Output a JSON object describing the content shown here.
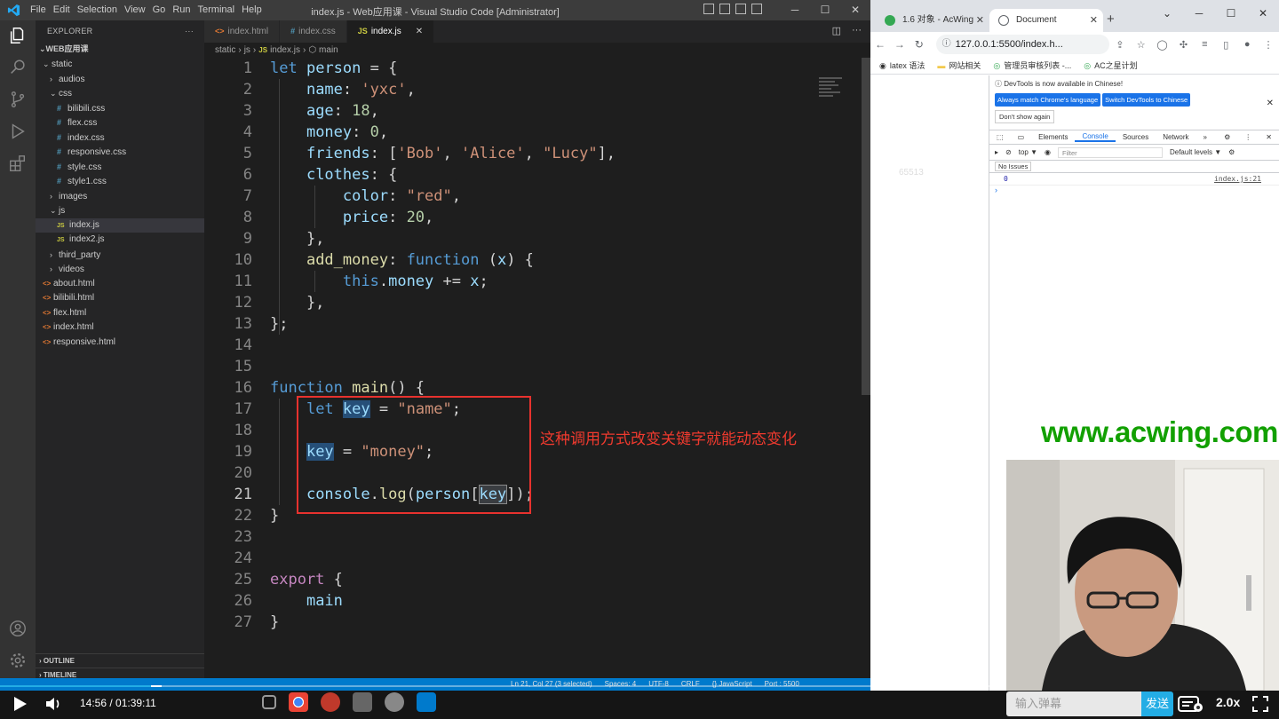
{
  "vscode": {
    "menu": [
      "File",
      "Edit",
      "Selection",
      "View",
      "Go",
      "Run",
      "Terminal",
      "Help"
    ],
    "window_title": "index.js - Web应用课 - Visual Studio Code [Administrator]",
    "explorer_label": "EXPLORER",
    "explorer_more": "···",
    "root_folder": "WEB应用课",
    "tree": [
      {
        "label": "static",
        "kind": "folder",
        "open": true,
        "depth": 0
      },
      {
        "label": "audios",
        "kind": "folder",
        "open": false,
        "depth": 1
      },
      {
        "label": "css",
        "kind": "folder",
        "open": true,
        "depth": 1
      },
      {
        "label": "bilibili.css",
        "kind": "css",
        "depth": 2
      },
      {
        "label": "flex.css",
        "kind": "css",
        "depth": 2
      },
      {
        "label": "index.css",
        "kind": "css",
        "depth": 2
      },
      {
        "label": "responsive.css",
        "kind": "css",
        "depth": 2
      },
      {
        "label": "style.css",
        "kind": "css",
        "depth": 2
      },
      {
        "label": "style1.css",
        "kind": "css",
        "depth": 2
      },
      {
        "label": "images",
        "kind": "folder",
        "open": false,
        "depth": 1
      },
      {
        "label": "js",
        "kind": "folder",
        "open": true,
        "depth": 1
      },
      {
        "label": "index.js",
        "kind": "js",
        "depth": 2,
        "active": true
      },
      {
        "label": "index2.js",
        "kind": "js",
        "depth": 2
      },
      {
        "label": "third_party",
        "kind": "folder",
        "open": false,
        "depth": 1
      },
      {
        "label": "videos",
        "kind": "folder",
        "open": false,
        "depth": 1
      },
      {
        "label": "about.html",
        "kind": "html",
        "depth": 0
      },
      {
        "label": "bilibili.html",
        "kind": "html",
        "depth": 0
      },
      {
        "label": "flex.html",
        "kind": "html",
        "depth": 0
      },
      {
        "label": "index.html",
        "kind": "html",
        "depth": 0
      },
      {
        "label": "responsive.html",
        "kind": "html",
        "depth": 0
      }
    ],
    "outline_label": "OUTLINE",
    "timeline_label": "TIMELINE",
    "tabs": [
      {
        "label": "index.html",
        "kind": "html",
        "active": false
      },
      {
        "label": "index.css",
        "kind": "css",
        "active": false
      },
      {
        "label": "index.js",
        "kind": "js",
        "active": true
      }
    ],
    "breadcrumb": [
      "static",
      "js",
      "index.js",
      "main"
    ],
    "current_line": 21,
    "code": [
      [
        [
          "k",
          "let"
        ],
        [
          "p",
          " "
        ],
        [
          "v",
          "person"
        ],
        [
          "p",
          " = {"
        ]
      ],
      [
        [
          "p",
          "    "
        ],
        [
          "v",
          "name"
        ],
        [
          "p",
          ": "
        ],
        [
          "s",
          "'yxc'"
        ],
        [
          "p",
          ","
        ]
      ],
      [
        [
          "p",
          "    "
        ],
        [
          "v",
          "age"
        ],
        [
          "p",
          ": "
        ],
        [
          "n",
          "18"
        ],
        [
          "p",
          ","
        ]
      ],
      [
        [
          "p",
          "    "
        ],
        [
          "v",
          "money"
        ],
        [
          "p",
          ": "
        ],
        [
          "n",
          "0"
        ],
        [
          "p",
          ","
        ]
      ],
      [
        [
          "p",
          "    "
        ],
        [
          "v",
          "friends"
        ],
        [
          "p",
          ": ["
        ],
        [
          "s",
          "'Bob'"
        ],
        [
          "p",
          ", "
        ],
        [
          "s",
          "'Alice'"
        ],
        [
          "p",
          ", "
        ],
        [
          "s",
          "\"Lucy\""
        ],
        [
          "p",
          "],"
        ]
      ],
      [
        [
          "p",
          "    "
        ],
        [
          "v",
          "clothes"
        ],
        [
          "p",
          ": {"
        ]
      ],
      [
        [
          "p",
          "        "
        ],
        [
          "v",
          "color"
        ],
        [
          "p",
          ": "
        ],
        [
          "s",
          "\"red\""
        ],
        [
          "p",
          ","
        ]
      ],
      [
        [
          "p",
          "        "
        ],
        [
          "v",
          "price"
        ],
        [
          "p",
          ": "
        ],
        [
          "n",
          "20"
        ],
        [
          "p",
          ","
        ]
      ],
      [
        [
          "p",
          "    },"
        ]
      ],
      [
        [
          "p",
          "    "
        ],
        [
          "f",
          "add_money"
        ],
        [
          "p",
          ": "
        ],
        [
          "k",
          "function"
        ],
        [
          "p",
          " ("
        ],
        [
          "v",
          "x"
        ],
        [
          "p",
          ") {"
        ]
      ],
      [
        [
          "p",
          "        "
        ],
        [
          "k",
          "this"
        ],
        [
          "p",
          "."
        ],
        [
          "v",
          "money"
        ],
        [
          "p",
          " += "
        ],
        [
          "v",
          "x"
        ],
        [
          "p",
          ";"
        ]
      ],
      [
        [
          "p",
          "    },"
        ]
      ],
      [
        [
          "p",
          "};"
        ]
      ],
      [],
      [],
      [
        [
          "k",
          "function"
        ],
        [
          "p",
          " "
        ],
        [
          "f",
          "main"
        ],
        [
          "p",
          "() {"
        ]
      ],
      [
        [
          "p",
          "    "
        ],
        [
          "k",
          "let"
        ],
        [
          "p",
          " "
        ],
        [
          "vh",
          "key"
        ],
        [
          "p",
          " = "
        ],
        [
          "s",
          "\"name\""
        ],
        [
          "p",
          ";"
        ]
      ],
      [],
      [
        [
          "p",
          "    "
        ],
        [
          "vh",
          "key"
        ],
        [
          "p",
          " = "
        ],
        [
          "s",
          "\"money\""
        ],
        [
          "p",
          ";"
        ]
      ],
      [],
      [
        [
          "p",
          "    "
        ],
        [
          "v",
          "console"
        ],
        [
          "p",
          "."
        ],
        [
          "f",
          "log"
        ],
        [
          "p",
          "("
        ],
        [
          "v",
          "person"
        ],
        [
          "p",
          "["
        ],
        [
          "vh2",
          "key"
        ],
        [
          "p",
          "]);"
        ]
      ],
      [
        [
          "p",
          "}"
        ]
      ],
      [],
      [],
      [
        [
          "kw",
          "export"
        ],
        [
          "p",
          " {"
        ]
      ],
      [
        [
          "p",
          "    "
        ],
        [
          "v",
          "main"
        ]
      ],
      [
        [
          "p",
          "}"
        ]
      ]
    ],
    "annotation": "这种调用方式改变关键字就能动态变化",
    "status": [
      "Ln 21, Col 27 (3 selected)",
      "Spaces: 4",
      "UTF-8",
      "CRLF",
      "{} JavaScript",
      "Port : 5500"
    ]
  },
  "chrome": {
    "tabs": [
      {
        "label": "1.6 对象 - AcWing",
        "active": false,
        "icon_color": "#34a853"
      },
      {
        "label": "Document",
        "active": true,
        "icon_color": "#5f6368"
      }
    ],
    "url": "127.0.0.1:5500/index.h...",
    "bookmarks": [
      "latex 语法",
      "网站相关",
      "管理员审核列表 -...",
      "AC之星计划"
    ],
    "page_number": "65513",
    "devtools": {
      "banner": "DevTools is now available in Chinese!",
      "btn_match": "Always match Chrome's language",
      "btn_switch": "Switch DevTools to Chinese",
      "btn_dont": "Don't show again",
      "tabs": [
        "Elements",
        "Console",
        "Sources",
        "Network",
        "»"
      ],
      "active_tab": "Console",
      "context": "top ▼",
      "filter_placeholder": "Filter",
      "levels": "Default levels ▼",
      "issues": "No Issues",
      "log_value": "0",
      "log_source": "index.js:21",
      "prompt": "›"
    }
  },
  "watermark": "www.acwing.com",
  "player": {
    "time": "14:56 / 01:39:11",
    "progress": 0.1507,
    "danmu_placeholder": "输入弹幕",
    "send": "发送",
    "speed": "2.0x"
  },
  "colors": {
    "accent": "#007acc",
    "player_accent": "#23ade5",
    "annotation_red": "#e8322e",
    "watermark_green": "#12a000"
  }
}
